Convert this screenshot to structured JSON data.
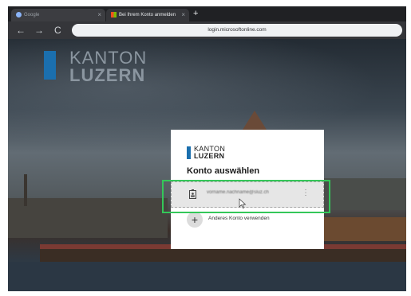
{
  "browser": {
    "tabs": [
      {
        "label": "Google",
        "active": false
      },
      {
        "label": "Bei Ihrem Konto anmelden",
        "active": true
      }
    ],
    "new_tab": "+",
    "close": "×",
    "nav": {
      "back": "←",
      "forward": "→",
      "reload": "C"
    },
    "url": "login.microsoftonline.com"
  },
  "brand": {
    "line1": "KANTON",
    "line2": "LUZERN",
    "color": "#1b6fae"
  },
  "dialog": {
    "logo_line1": "KANTON",
    "logo_line2": "LUZERN",
    "title": "Konto auswählen",
    "account_email": "vorname.nachname@sluz.ch",
    "more_icon": "⋮",
    "add_account_icon": "+",
    "add_account_label": "Anderes Konto verwenden"
  },
  "colors": {
    "accent_blue": "#1b6fae",
    "highlight_green": "#34c759"
  }
}
